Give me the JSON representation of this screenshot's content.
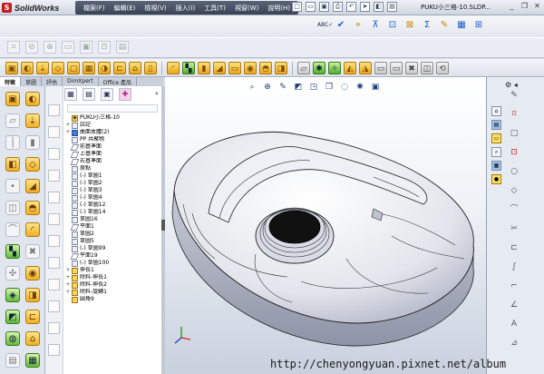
{
  "app": {
    "logo_text": "SolidWorks",
    "logo_mark": "S",
    "document_title": "PUKU小三格-10.SLDP..."
  },
  "menubar": {
    "items": [
      "檔案(F)",
      "編輯(E)",
      "檢視(V)",
      "插入(I)",
      "工具(T)",
      "視窗(W)",
      "說明(H)"
    ]
  },
  "tabs": [
    "特徵",
    "草圖",
    "評估",
    "DimXpert",
    "Office 產品"
  ],
  "tree": {
    "root": "PUKU小三格-10",
    "items": [
      {
        "label": "註記",
        "exp": "+",
        "icon": "annotation-icon"
      },
      {
        "label": "曲面本體(2)",
        "exp": "+",
        "icon": "surface-body-icon"
      },
      {
        "label": "PP 共聚物",
        "exp": "",
        "icon": "material-icon"
      },
      {
        "label": "前基準面",
        "exp": "",
        "icon": "plane-icon"
      },
      {
        "label": "上基準面",
        "exp": "",
        "icon": "plane-icon"
      },
      {
        "label": "右基準面",
        "exp": "",
        "icon": "plane-icon"
      },
      {
        "label": "原點",
        "exp": "",
        "icon": "origin-icon"
      },
      {
        "label": "(-) 草圖1",
        "exp": "",
        "icon": "sketch-icon"
      },
      {
        "label": "(-) 草圖2",
        "exp": "",
        "icon": "sketch-icon"
      },
      {
        "label": "(-) 草圖3",
        "exp": "",
        "icon": "sketch-icon"
      },
      {
        "label": "(-) 草圖4",
        "exp": "",
        "icon": "sketch-icon"
      },
      {
        "label": "(-) 草圖12",
        "exp": "",
        "icon": "sketch-icon"
      },
      {
        "label": "(-) 草圖14",
        "exp": "",
        "icon": "sketch-icon"
      },
      {
        "label": "草圖16",
        "exp": "",
        "icon": "sketch-icon"
      },
      {
        "label": "平面1",
        "exp": "",
        "icon": "plane-icon"
      },
      {
        "label": "草圖2",
        "exp": "",
        "icon": "sketch-icon"
      },
      {
        "label": "草圖5",
        "exp": "",
        "icon": "sketch-icon"
      },
      {
        "label": "(-) 草圖99",
        "exp": "",
        "icon": "sketch-icon"
      },
      {
        "label": "平面19",
        "exp": "",
        "icon": "plane-icon"
      },
      {
        "label": "(-) 草圖100",
        "exp": "",
        "icon": "sketch-icon"
      },
      {
        "label": "伸長1",
        "exp": "+",
        "icon": "extrude-icon"
      },
      {
        "label": "除料-伸長1",
        "exp": "+",
        "icon": "cut-extrude-icon"
      },
      {
        "label": "除料-伸長2",
        "exp": "+",
        "icon": "cut-extrude-icon"
      },
      {
        "label": "除料-旋轉1",
        "exp": "+",
        "icon": "cut-revolve-icon"
      },
      {
        "label": "圓角9",
        "exp": "",
        "icon": "fillet-icon"
      }
    ]
  },
  "watermark": "http://chenyongyuan.pixnet.net/album",
  "colors": {
    "accent": "#3b4456",
    "brand_red": "#c21d1d",
    "feature_yellow": "#eeae25",
    "viewport_top": "#ffffff",
    "viewport_bottom": "#c9d1de"
  },
  "toolbar_icons": {
    "quick": [
      "new-icon",
      "open-icon",
      "save-icon",
      "print-icon",
      "undo-icon",
      "select-icon",
      "rebuild-icon",
      "options-icon"
    ],
    "sketch_row": [
      "spell-check-icon",
      "check-icon",
      "dimension-icon",
      "line-icon",
      "smart-dim-icon",
      "relation-icon",
      "sigma-icon",
      "measure-icon",
      "table-icon",
      "grid-icon"
    ]
  }
}
